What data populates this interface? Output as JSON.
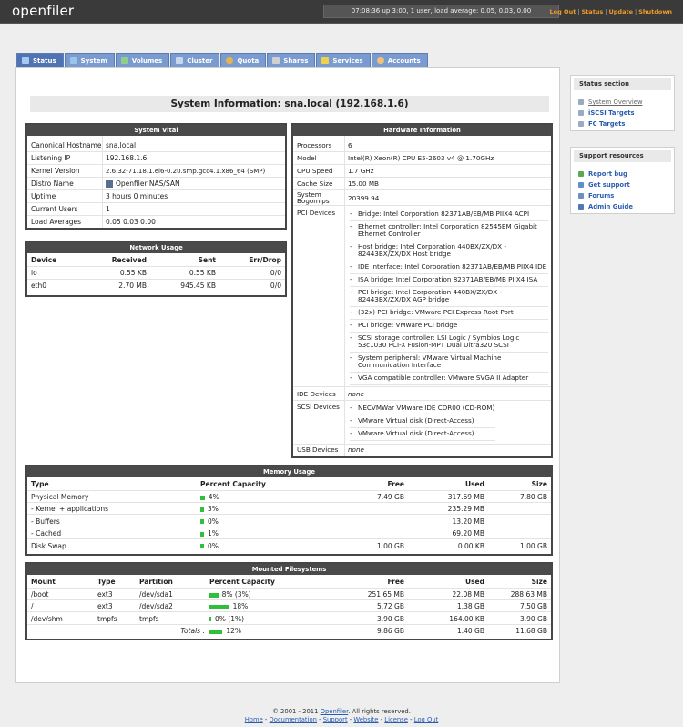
{
  "header": {
    "logo": "openfiler",
    "sysinfo": "07:08:36 up 3:00, 1 user, load average: 0.05, 0.03, 0.00",
    "links": [
      "Log Out",
      "Status",
      "Update",
      "Shutdown"
    ]
  },
  "tabs": [
    "Status",
    "System",
    "Volumes",
    "Cluster",
    "Quota",
    "Shares",
    "Services",
    "Accounts"
  ],
  "page_title": "System Information: sna.local (192.168.1.6)",
  "system_vital": {
    "title": "System Vital",
    "rows": [
      {
        "label": "Canonical Hostname",
        "value": "sna.local"
      },
      {
        "label": "Listening IP",
        "value": "192.168.1.6"
      },
      {
        "label": "Kernel Version",
        "value": "2.6.32-71.18.1.el6-0.20.smp.gcc4.1.x86_64 (SMP)"
      },
      {
        "label": "Distro Name",
        "value": "Openfiler NAS/SAN"
      },
      {
        "label": "Uptime",
        "value": "3 hours 0 minutes"
      },
      {
        "label": "Current Users",
        "value": "1"
      },
      {
        "label": "Load Averages",
        "value": "0.05 0.03 0.00"
      }
    ]
  },
  "network": {
    "title": "Network Usage",
    "headers": [
      "Device",
      "Received",
      "Sent",
      "Err/Drop"
    ],
    "rows": [
      [
        "lo",
        "0.55 KB",
        "0.55 KB",
        "0/0"
      ],
      [
        "eth0",
        "2.70 MB",
        "945.45 KB",
        "0/0"
      ]
    ]
  },
  "hardware": {
    "title": "Hardware Information",
    "processors_label": "Processors",
    "processors": "6",
    "model_label": "Model",
    "model": "Intel(R) Xeon(R) CPU E5-2603 v4 @ 1.70GHz",
    "cpu_speed_label": "CPU Speed",
    "cpu_speed": "1.7 GHz",
    "cache_label": "Cache Size",
    "cache": "15.00 MB",
    "bogomips_label": "System Bogomips",
    "bogomips": "20399.94",
    "pci_label": "PCI Devices",
    "pci": [
      "Bridge: Intel Corporation 82371AB/EB/MB PIIX4 ACPI",
      "Ethernet controller: Intel Corporation 82545EM Gigabit Ethernet Controller",
      "Host bridge: Intel Corporation 440BX/ZX/DX - 82443BX/ZX/DX Host bridge",
      "IDE interface: Intel Corporation 82371AB/EB/MB PIIX4 IDE",
      "ISA bridge: Intel Corporation 82371AB/EB/MB PIIX4 ISA",
      "PCI bridge: Intel Corporation 440BX/ZX/DX - 82443BX/ZX/DX AGP bridge",
      "(32x) PCI bridge: VMware PCI Express Root Port",
      "PCI bridge: VMware PCI bridge",
      "SCSI storage controller: LSI Logic / Symbios Logic 53c1030 PCI-X Fusion-MPT Dual Ultra320 SCSI",
      "System peripheral: VMware Virtual Machine Communication Interface",
      "VGA compatible controller: VMware SVGA II Adapter"
    ],
    "ide_label": "IDE Devices",
    "ide": "none",
    "scsi_label": "SCSI Devices",
    "scsi": [
      "NECVMWar VMware IDE CDR00 (CD-ROM)",
      "VMware Virtual disk (Direct-Access)",
      "VMware Virtual disk (Direct-Access)"
    ],
    "usb_label": "USB Devices",
    "usb": "none"
  },
  "memory": {
    "title": "Memory Usage",
    "headers": [
      "Type",
      "Percent Capacity",
      "Free",
      "Used",
      "Size"
    ],
    "rows": [
      {
        "type": "Physical Memory",
        "pct": 4,
        "pct_label": "4%",
        "free": "7.49 GB",
        "used": "317.69 MB",
        "size": "7.80 GB"
      },
      {
        "type": "- Kernel + applications",
        "pct": 3,
        "pct_label": "3%",
        "free": "",
        "used": "235.29 MB",
        "size": ""
      },
      {
        "type": "- Buffers",
        "pct": 0,
        "pct_label": "0%",
        "free": "",
        "used": "13.20 MB",
        "size": ""
      },
      {
        "type": "- Cached",
        "pct": 1,
        "pct_label": "1%",
        "free": "",
        "used": "69.20 MB",
        "size": ""
      },
      {
        "type": "Disk Swap",
        "pct": 0,
        "pct_label": "0%",
        "free": "1.00 GB",
        "used": "0.00 KB",
        "size": "1.00 GB"
      }
    ]
  },
  "filesystems": {
    "title": "Mounted Filesystems",
    "headers": [
      "Mount",
      "Type",
      "Partition",
      "Percent Capacity",
      "Free",
      "Used",
      "Size"
    ],
    "rows": [
      {
        "mount": "/boot",
        "type": "ext3",
        "partition": "/dev/sda1",
        "pct": 8,
        "pct_label": "8% (3%)",
        "free": "251.65 MB",
        "used": "22.08 MB",
        "size": "288.63 MB"
      },
      {
        "mount": "/",
        "type": "ext3",
        "partition": "/dev/sda2",
        "pct": 18,
        "pct_label": "18%",
        "free": "5.72 GB",
        "used": "1.38 GB",
        "size": "7.50 GB"
      },
      {
        "mount": "/dev/shm",
        "type": "tmpfs",
        "partition": "tmpfs",
        "pct": 0,
        "pct_label": "0% (1%)",
        "free": "3.90 GB",
        "used": "164.00 KB",
        "size": "3.90 GB"
      }
    ],
    "totals_label": "Totals :",
    "totals": {
      "pct": 12,
      "pct_label": "12%",
      "free": "9.86 GB",
      "used": "1.40 GB",
      "size": "11.68 GB"
    }
  },
  "status_section": {
    "title": "Status section",
    "items": [
      "System Overview",
      "iSCSI Targets",
      "FC Targets"
    ]
  },
  "support": {
    "title": "Support resources",
    "items": [
      "Report bug",
      "Get support",
      "Forums",
      "Admin Guide"
    ]
  },
  "footer": {
    "copyright_pre": "© 2001 - 2011",
    "brand": "Openfiler",
    "copyright_post": ". All rights reserved.",
    "links": [
      "Home",
      "Documentation",
      "Support",
      "Website",
      "License",
      "Log Out"
    ]
  }
}
